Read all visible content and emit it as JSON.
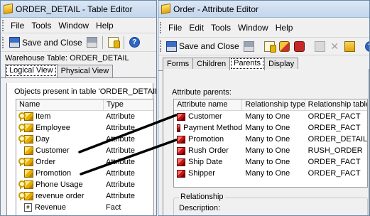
{
  "left_window": {
    "title": "ORDER_DETAIL - Table Editor",
    "menu": [
      "File",
      "Tools",
      "Window",
      "Help"
    ],
    "toolbar": {
      "save_close_label": "Save and Close"
    },
    "warehouse_label": "Warehouse Table: ORDER_DETAIL",
    "tabs": [
      "Logical View",
      "Physical View"
    ],
    "objects_label": "Objects present in table 'ORDER_DETAIL':",
    "columns": [
      "Name",
      "Type"
    ],
    "rows": [
      {
        "name": "Item",
        "type": "Attribute",
        "key": true,
        "icon": "attribute-icon"
      },
      {
        "name": "Employee",
        "type": "Attribute",
        "key": true,
        "icon": "attribute-icon"
      },
      {
        "name": "Day",
        "type": "Attribute",
        "key": true,
        "icon": "attribute-icon"
      },
      {
        "name": "Customer",
        "type": "Attribute",
        "key": false,
        "icon": "attribute-icon"
      },
      {
        "name": "Order",
        "type": "Attribute",
        "key": true,
        "icon": "attribute-icon"
      },
      {
        "name": "Promotion",
        "type": "Attribute",
        "key": false,
        "icon": "attribute-icon"
      },
      {
        "name": "Phone Usage",
        "type": "Attribute",
        "key": true,
        "icon": "attribute-icon"
      },
      {
        "name": "revenue order",
        "type": "Attribute",
        "key": true,
        "icon": "attribute-icon"
      },
      {
        "name": "Revenue",
        "type": "Fact",
        "key": false,
        "icon": "fact-icon"
      }
    ]
  },
  "right_window": {
    "title": "Order - Attribute Editor",
    "menu": [
      "File",
      "Edit",
      "Tools",
      "Window",
      "Help"
    ],
    "toolbar": {
      "save_close_label": "Save and Close"
    },
    "tabs": [
      "Forms",
      "Children",
      "Parents",
      "Display"
    ],
    "active_tab": "Parents",
    "parents_label": "Attribute parents:",
    "columns": [
      "Attribute name",
      "Relationship type",
      "Relationship table"
    ],
    "rows": [
      {
        "name": "Customer",
        "relationship": "Many to One",
        "table": "ORDER_FACT"
      },
      {
        "name": "Payment Method",
        "relationship": "Many to One",
        "table": "ORDER_FACT"
      },
      {
        "name": "Promotion",
        "relationship": "Many to One",
        "table": "ORDER_DETAIL"
      },
      {
        "name": "Rush Order",
        "relationship": "Many to One",
        "table": "RUSH_ORDER"
      },
      {
        "name": "Ship Date",
        "relationship": "Many to One",
        "table": "ORDER_FACT"
      },
      {
        "name": "Shipper",
        "relationship": "Many to One",
        "table": "ORDER_FACT"
      }
    ],
    "relationship_group_label": "Relationship",
    "description_label": "Description:"
  },
  "colors": {
    "titlebar": "#c3d6ec",
    "window_bg": "#f0f0f0",
    "connector_line": "#000000",
    "attribute_icon": "#e9ad00",
    "parent_icon": "#c41515"
  }
}
